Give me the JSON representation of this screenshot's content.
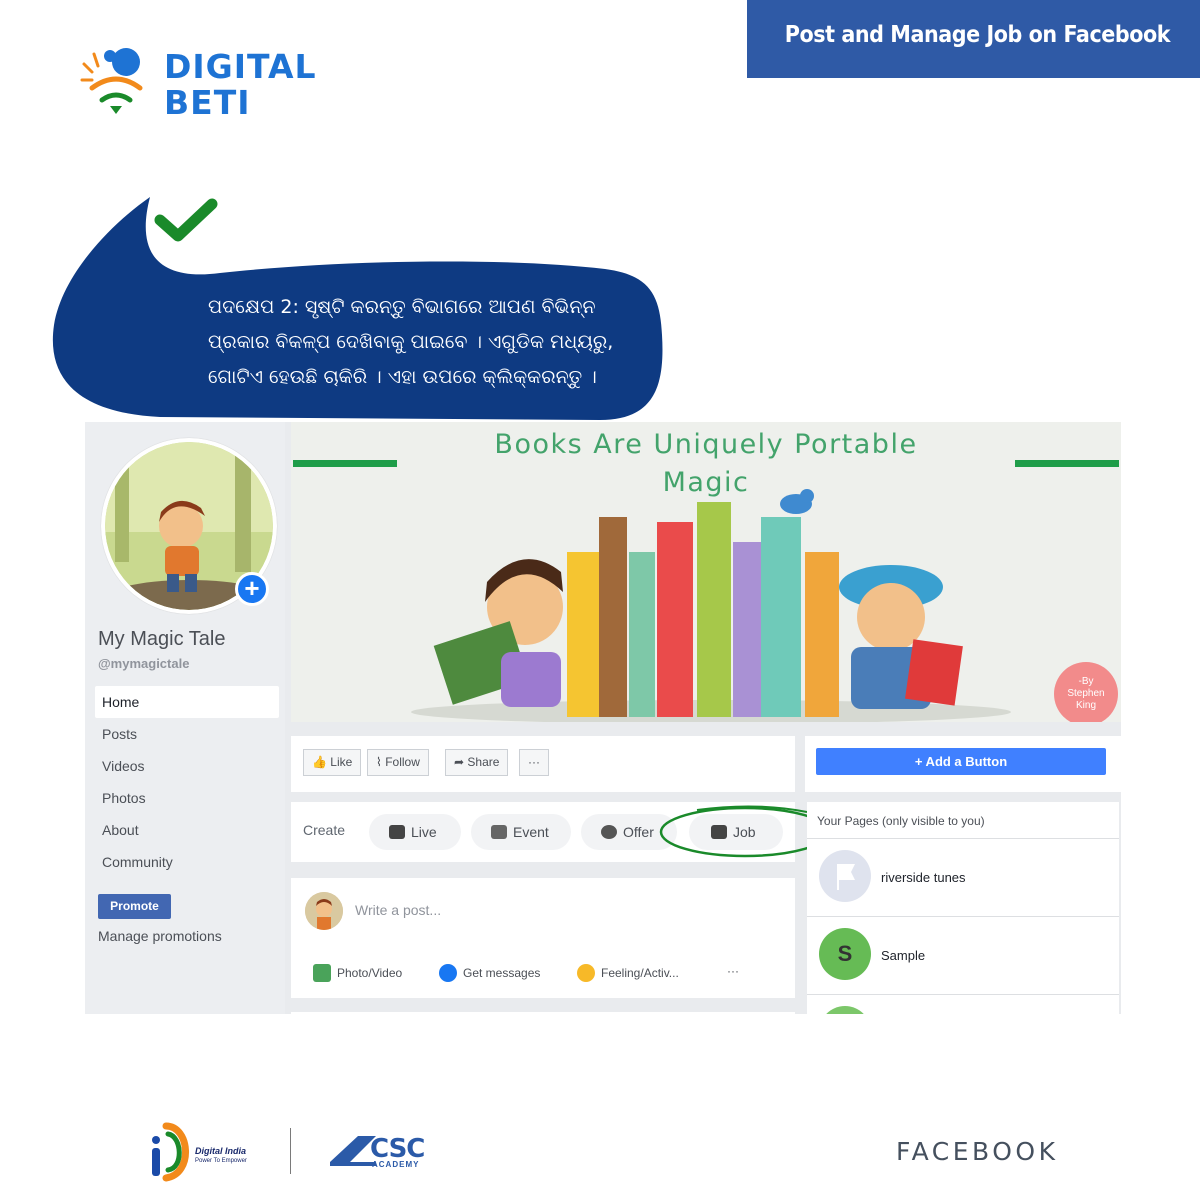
{
  "brand": {
    "logo_line1": "DIGITAL",
    "logo_line2": "BETI",
    "logo_color": "#1e73d4"
  },
  "banner": {
    "title": "Post and Manage Job on Facebook",
    "color": "#2f5aa6"
  },
  "instruction": {
    "check_icon": "checkmark-icon",
    "check_color": "#1a8a2a",
    "bubble_color": "#0e3a82",
    "lines": [
      "ପଦକ୍ଷେପ 2: ସୃଷ୍ଟି କରନ୍ତୁ ବିଭାଗରେ ଆପଣ ବିଭିନ୍ନ",
      "ପ୍ରକାର ବିକଳ୍ପ ଦେଖିବାକୁ ପାଇବେ । ଏଗୁଡିକ ମଧ୍ୟରୁ,",
      "ଗୋଟିଏ ହେଉଛି ଚାକିରି । ଏହା ଉପରେ କ୍ଲିକ୍କରନ୍ତୁ ।"
    ]
  },
  "fb": {
    "page_name": "My Magic Tale",
    "page_handle": "@mymagictale",
    "nav": [
      "Home",
      "Posts",
      "Videos",
      "Photos",
      "About",
      "Community"
    ],
    "active_nav": "Home",
    "promote_label": "Promote",
    "manage_promotions": "Manage promotions",
    "cover": {
      "title_line1": "Books Are Uniquely Portable",
      "title_line2": "Magic",
      "stamp_lines": [
        "-By",
        "Stephen",
        "King"
      ]
    },
    "actions": {
      "like": "Like",
      "follow": "Follow",
      "share": "Share",
      "more": "···"
    },
    "add_button": "+ Add a Button",
    "create": {
      "label": "Create",
      "options": [
        "Live",
        "Event",
        "Offer",
        "Job"
      ],
      "highlight": "Job",
      "highlight_color": "#1a8a2a"
    },
    "composer": {
      "placeholder": "Write a post...",
      "options": [
        "Photo/Video",
        "Get messages",
        "Feeling/Activ...",
        "···"
      ]
    },
    "your_pages": {
      "title": "Your Pages (only visible to you)",
      "pages": [
        {
          "name": "riverside tunes"
        },
        {
          "name": "Sample",
          "initial": "S"
        }
      ]
    }
  },
  "footer": {
    "digital_india": "Digital India",
    "digital_india_tagline": "Power To Empower",
    "csc": "CSC",
    "csc_sub": "ACADEMY",
    "facebook": "FACEBOOK"
  }
}
